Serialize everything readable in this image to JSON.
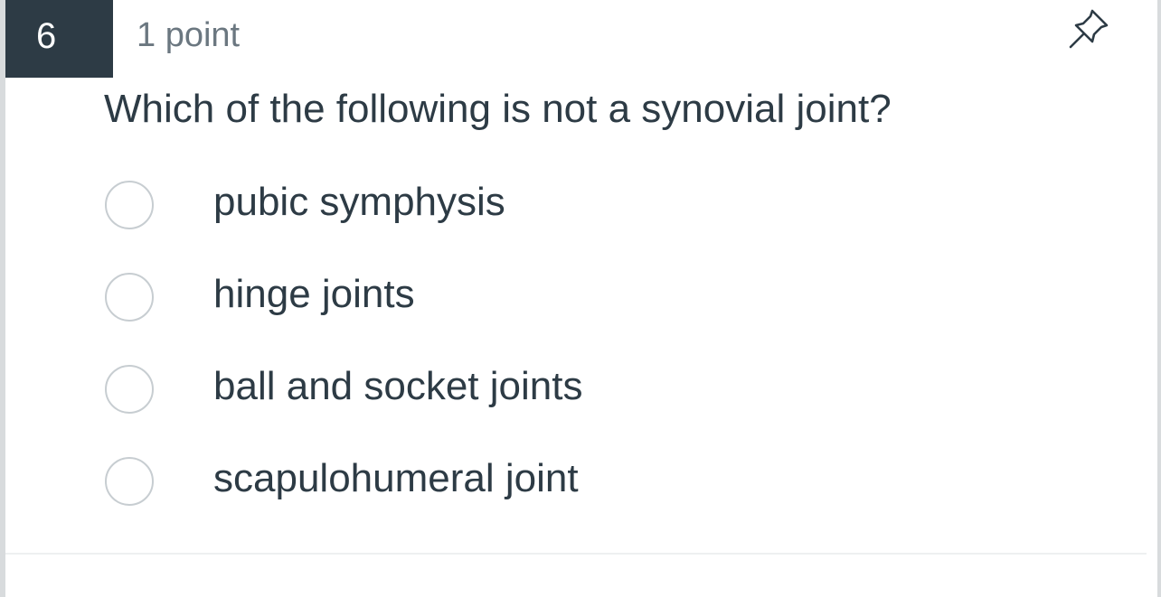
{
  "question": {
    "number": "6",
    "points": "1 point",
    "text": "Which of the following is not a synovial joint?",
    "pin_icon": "pin-icon",
    "answers": [
      {
        "label": "pubic symphysis",
        "selected": false
      },
      {
        "label": "hinge joints",
        "selected": false
      },
      {
        "label": "ball and socket joints",
        "selected": false
      },
      {
        "label": "scapulohumeral joint",
        "selected": false
      }
    ]
  },
  "colors": {
    "badge_bg": "#2d3b45",
    "text": "#2d3b45",
    "muted_text": "#6b7780",
    "radio_border": "#c7cdd1"
  }
}
